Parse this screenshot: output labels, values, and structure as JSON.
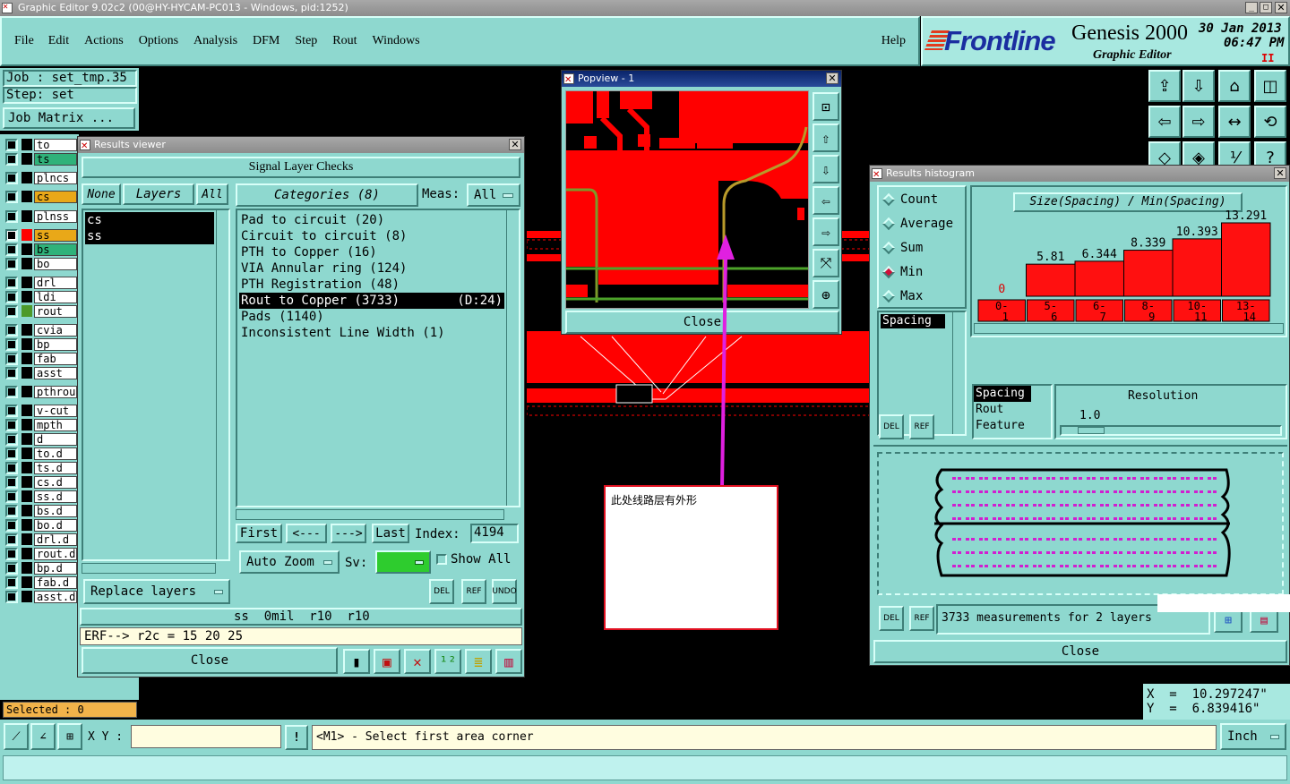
{
  "app": {
    "title": "Graphic Editor 9.02c2 (00@HY-HYCAM-PC013 - Windows, pid:1252)",
    "brand": "Frontline",
    "product": "Genesis 2000",
    "subtitle": "Graphic Editor",
    "date": "30 Jan 2013",
    "time": "06:47 PM",
    "pause": "II"
  },
  "menu": [
    "File",
    "Edit",
    "Actions",
    "Options",
    "Analysis",
    "DFM",
    "Step",
    "Rout",
    "Windows"
  ],
  "help": "Help",
  "job": {
    "job": "Job : set_tmp.35",
    "step": "Step: set",
    "matrix_button": "Job Matrix ..."
  },
  "layers": [
    {
      "name": "to",
      "color": "#000000"
    },
    {
      "name": "ts",
      "color": "#000000",
      "highlight": "#2fb27a"
    },
    {
      "name": "plncs",
      "color": "#000000"
    },
    {
      "name": "cs",
      "color": "#000000",
      "highlight": "#e9a818"
    },
    {
      "name": "plnss",
      "color": "#000000"
    },
    {
      "name": "ss",
      "color": "#ff0000",
      "highlight": "#e9a818",
      "active": true
    },
    {
      "name": "bs",
      "color": "#000000",
      "highlight": "#2fb27a"
    },
    {
      "name": "bo",
      "color": "#000000"
    },
    {
      "name": "drl",
      "color": "#000000"
    },
    {
      "name": "ldi",
      "color": "#000000"
    },
    {
      "name": "rout",
      "color": "#4d9a2a"
    },
    {
      "name": "cvia",
      "color": "#000000"
    },
    {
      "name": "bp",
      "color": "#000000"
    },
    {
      "name": "fab",
      "color": "#000000"
    },
    {
      "name": "asst",
      "color": "#000000"
    },
    {
      "name": "pthrou",
      "color": "#000000"
    },
    {
      "name": "v-cut",
      "color": "#000000"
    },
    {
      "name": "mpth",
      "color": "#000000"
    },
    {
      "name": "d",
      "color": "#000000"
    },
    {
      "name": "to.d",
      "color": "#000000"
    },
    {
      "name": "ts.d",
      "color": "#000000"
    },
    {
      "name": "cs.d",
      "color": "#000000"
    },
    {
      "name": "ss.d",
      "color": "#000000"
    },
    {
      "name": "bs.d",
      "color": "#000000"
    },
    {
      "name": "bo.d",
      "color": "#000000"
    },
    {
      "name": "drl.d",
      "color": "#000000"
    },
    {
      "name": "rout.d",
      "color": "#000000"
    },
    {
      "name": "bp.d",
      "color": "#000000"
    },
    {
      "name": "fab.d",
      "color": "#000000"
    },
    {
      "name": "asst.d",
      "color": "#000000"
    }
  ],
  "selected": "Selected : 0",
  "results_viewer": {
    "title": "Results viewer",
    "heading": "Signal Layer Checks",
    "none": "None",
    "layers_btn": "Layers",
    "all": "All",
    "categories": "Categories (8)",
    "meas_label": "Meas:",
    "meas_value": "All",
    "layer_list": [
      "cs",
      "ss"
    ],
    "category_list": [
      {
        "label": "Pad to circuit (20)",
        "extra": ""
      },
      {
        "label": "Circuit to circuit (8)",
        "extra": ""
      },
      {
        "label": "PTH to Copper (16)",
        "extra": ""
      },
      {
        "label": "VIA Annular ring (124)",
        "extra": ""
      },
      {
        "label": "PTH Registration (48)",
        "extra": ""
      },
      {
        "label": "Rout to Copper (3733)",
        "extra": "(D:24)"
      },
      {
        "label": "Pads (1140)",
        "extra": ""
      },
      {
        "label": "Inconsistent Line Width (1)",
        "extra": ""
      }
    ],
    "first": "First",
    "prev": "<---",
    "next": "--->",
    "last": "Last",
    "index_label": "Index:",
    "index_value": "4194",
    "auto_zoom": "Auto Zoom",
    "sv_label": "Sv:",
    "show_all": "Show All",
    "replace_layers": "Replace layers",
    "status": "ss  0mil  r10  r10",
    "erf": "ERF--> r2c = 15 20 25",
    "close": "Close",
    "del": "DEL",
    "ref": "REF",
    "undo": "UNDO"
  },
  "popview": {
    "title": "Popview - 1",
    "close": "Close"
  },
  "annotation": {
    "text": "此处线路层有外形"
  },
  "histogram": {
    "title": "Results histogram",
    "modes": [
      "Count",
      "Average",
      "Sum",
      "Min",
      "Max"
    ],
    "selected_mode": "Min",
    "chart_title": "Size(Spacing) / Min(Spacing)",
    "list_item": "Spacing",
    "properties": [
      "Spacing",
      "Rout",
      "Feature"
    ],
    "resolution_label": "Resolution",
    "resolution_value": "1.0",
    "measurements": "3733 measurements for 2 layers",
    "close": "Close",
    "chart_data": {
      "type": "bar",
      "categories": [
        "0-1",
        "5-6",
        "6-7",
        "8-9",
        "10-11",
        "13-14"
      ],
      "values": [
        0,
        5.81,
        6.344,
        8.339,
        10.393,
        13.291
      ],
      "value_labels": [
        "0",
        "5.81",
        "6.344",
        "8.339",
        "10.393",
        "13.291"
      ],
      "ylim": [
        0,
        13.291
      ],
      "bar_color": "#ff1010"
    }
  },
  "coords": {
    "x": "X  =  10.297247\"",
    "y": "Y  =  6.839416\""
  },
  "bottom": {
    "xy_label": "X Y :",
    "xy_value": "",
    "prompt": "<M1> - Select first area corner",
    "units": "Inch"
  }
}
